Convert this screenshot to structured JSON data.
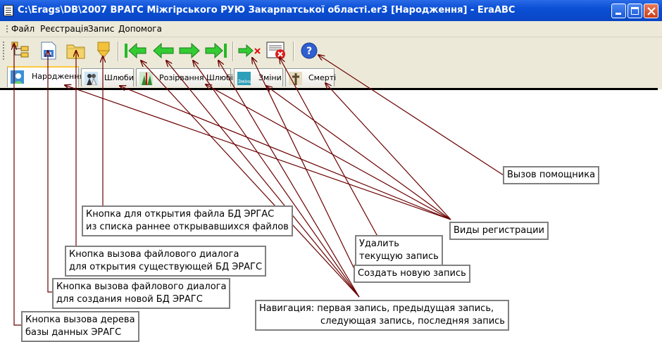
{
  "window": {
    "title": "C:\\Erags\\DB\\2007 ВРАГС Міжгірського РУЮ Закарпатської області.er3 [Народження] - EraABC"
  },
  "menu": {
    "items": [
      "Файл",
      "Реєстрація",
      "Запис",
      "Допомога"
    ]
  },
  "toolbar": {
    "buttons": [
      {
        "icon": "database-tree-icon"
      },
      {
        "icon": "new-database-icon"
      },
      {
        "icon": "open-folder-icon"
      },
      {
        "icon": "recent-files-dropdown-icon"
      },
      {
        "icon": "first-record-icon"
      },
      {
        "icon": "previous-record-icon"
      },
      {
        "icon": "next-record-icon"
      },
      {
        "icon": "last-record-icon"
      },
      {
        "icon": "new-record-icon"
      },
      {
        "icon": "delete-record-icon"
      },
      {
        "icon": "help-icon"
      }
    ]
  },
  "tabs": [
    {
      "label": "Народження",
      "active": true
    },
    {
      "label": "Шлюби",
      "active": false
    },
    {
      "label": "Розірвання Шлюбів",
      "active": false
    },
    {
      "label": "Зміни",
      "active": false
    },
    {
      "label": "Смерті",
      "active": false
    }
  ],
  "callouts": {
    "help": "Вызов помощника",
    "recent_files": [
      "Кнопка для открытия файла БД ЭРГАС",
      "из списка раннее открывавшихся файлов"
    ],
    "registration_kinds": "Виды регистрации",
    "delete_record": [
      "Удалить",
      "текущую запись"
    ],
    "open_existing": [
      "Кнопка вызова файлового диалога",
      "для открытия существующей БД ЭРАГС"
    ],
    "create_record": "Создать новую запись",
    "create_database": [
      "Кнопка вызова файлового диалога",
      "для создания новой БД ЭРАГС"
    ],
    "navigation": [
      "Навигация: первая запись, предыдущая запись,",
      "следующая запись, последняя запись"
    ],
    "tree": [
      "Кнопка вызова дерева",
      "базы данных ЭРАГС"
    ]
  },
  "colors": {
    "titlebar": "#0a4fd6",
    "chrome": "#ece9d8",
    "arrow": "#6b0000",
    "nav_green": "#27b827"
  }
}
